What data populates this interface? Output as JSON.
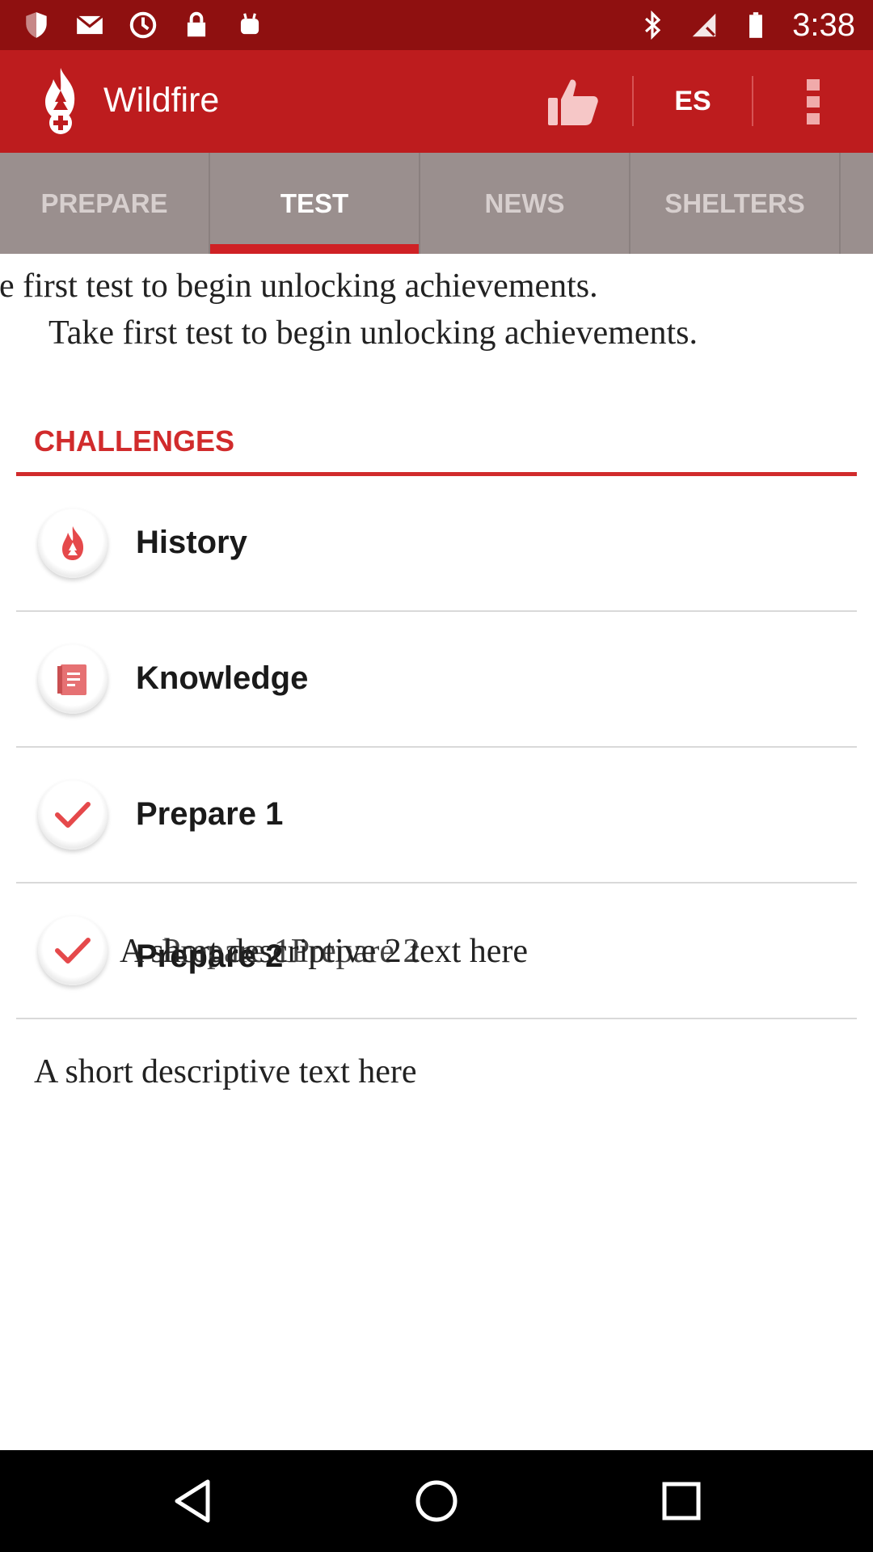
{
  "status_bar": {
    "time": "3:38",
    "icons": [
      "shield-icon",
      "mail-icon",
      "sync-icon",
      "lock-icon",
      "android-icon",
      "bluetooth-icon",
      "no-sim-icon",
      "battery-icon"
    ]
  },
  "app_bar": {
    "title": "Wildfire",
    "logo": "wildfire-logo-icon",
    "actions": {
      "like_icon": "thumbs-up-icon",
      "language_label": "ES",
      "menu_icon": "more-vert-icon"
    },
    "colors": {
      "app_bar": "#bd1c1e",
      "status_bar": "#8f1010"
    }
  },
  "tabs": [
    {
      "label": "PREPARE",
      "active": false
    },
    {
      "label": "TEST",
      "active": true
    },
    {
      "label": "NEWS",
      "active": false
    },
    {
      "label": "SHELTERS",
      "active": false
    }
  ],
  "messages": {
    "line1": "ke first test to begin unlocking achievements.",
    "line2": "Take first test to begin unlocking achievements."
  },
  "challenges": {
    "title": "CHALLENGES",
    "items": [
      {
        "label": "History",
        "icon": "flame-icon"
      },
      {
        "label": "Knowledge",
        "icon": "book-icon"
      },
      {
        "label": "Prepare 1",
        "icon": "checkmark-icon"
      },
      {
        "label": "Prepare 2",
        "icon": "checkmark-icon"
      }
    ],
    "overlap_text_1": "A short descriptive 2 text here",
    "overlap_text_2": "Prepare 1Prepare 2"
  },
  "description": "A short descriptive text here",
  "nav_bar": {
    "back_icon": "back-triangle-icon",
    "home_icon": "home-circle-icon",
    "recents_icon": "recents-square-icon"
  },
  "accent_color": "#d12b2c"
}
